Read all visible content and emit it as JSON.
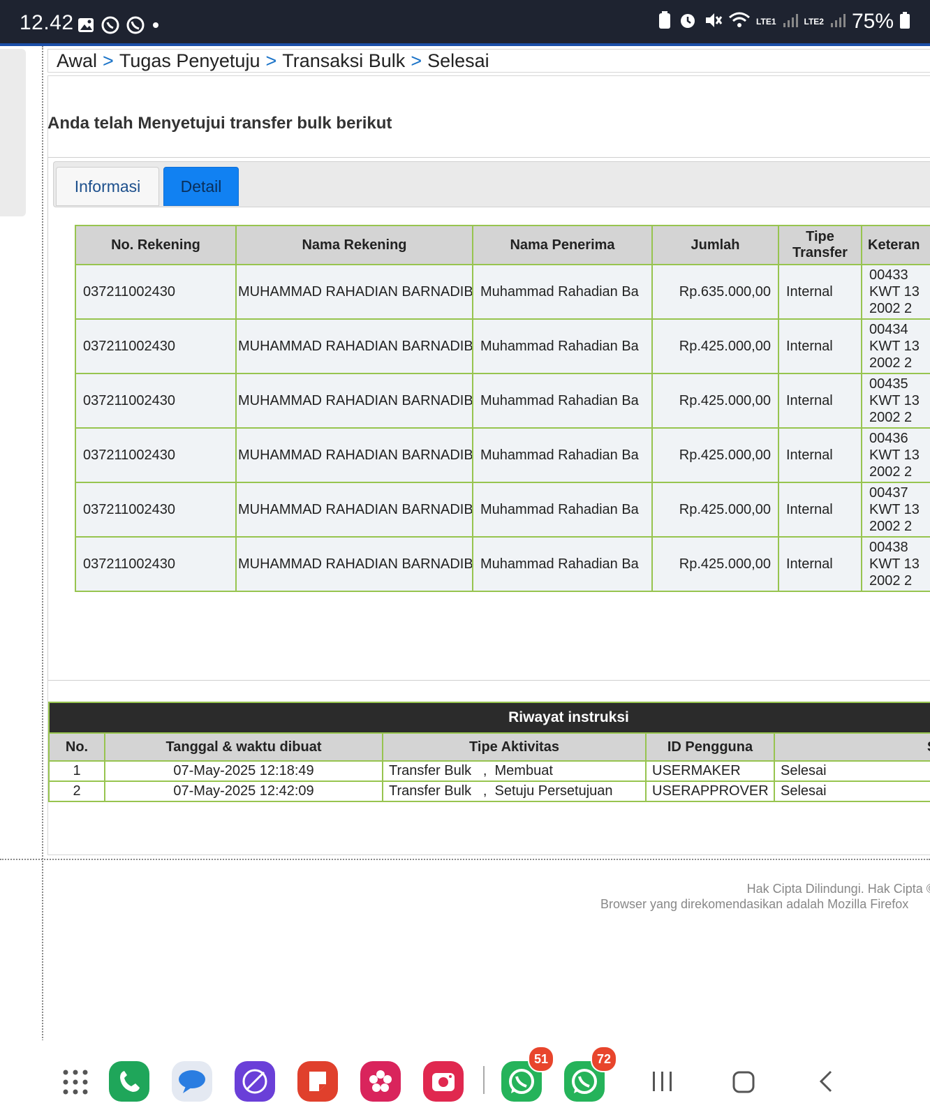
{
  "status_bar": {
    "time": "12.42",
    "battery": "75%",
    "network_labels": [
      "LTE1",
      "LTE2"
    ],
    "icons": [
      "gallery-icon",
      "sync-call-icon",
      "whatsapp-icon",
      "dot-icon",
      "battery-saver-icon",
      "alarm-icon",
      "mute-icon",
      "wifi-icon",
      "signal-icon",
      "signal-icon",
      "battery-icon"
    ]
  },
  "breadcrumb": {
    "items": [
      "Awal",
      "Tugas Penyetuju",
      "Transaksi Bulk",
      "Selesai"
    ],
    "separator": ">"
  },
  "page": {
    "title": "Anda telah Menyetujui transfer bulk berikut"
  },
  "tabs": [
    {
      "label": "Informasi",
      "active": false
    },
    {
      "label": "Detail",
      "active": true
    }
  ],
  "detail_table": {
    "headers": [
      "No. Rekening",
      "Nama Rekening",
      "Nama Penerima",
      "Jumlah",
      "Tipe Transfer",
      "Keteran"
    ],
    "rows": [
      {
        "rekening": "037211002430",
        "nama_rekening": "MUHAMMAD RAHADIAN BARNADIB",
        "penerima": "Muhammad Rahadian Ba",
        "jumlah": "Rp.635.000,00",
        "tipe": "Internal",
        "ket1": "00433",
        "ket2": "KWT 13",
        "ket3": "2002 2"
      },
      {
        "rekening": "037211002430",
        "nama_rekening": "MUHAMMAD RAHADIAN BARNADIB",
        "penerima": "Muhammad Rahadian Ba",
        "jumlah": "Rp.425.000,00",
        "tipe": "Internal",
        "ket1": "00434",
        "ket2": "KWT 13",
        "ket3": "2002 2"
      },
      {
        "rekening": "037211002430",
        "nama_rekening": "MUHAMMAD RAHADIAN BARNADIB",
        "penerima": "Muhammad Rahadian Ba",
        "jumlah": "Rp.425.000,00",
        "tipe": "Internal",
        "ket1": "00435",
        "ket2": "KWT 13",
        "ket3": "2002 2"
      },
      {
        "rekening": "037211002430",
        "nama_rekening": "MUHAMMAD RAHADIAN BARNADIB",
        "penerima": "Muhammad Rahadian Ba",
        "jumlah": "Rp.425.000,00",
        "tipe": "Internal",
        "ket1": "00436",
        "ket2": "KWT 13",
        "ket3": "2002 2"
      },
      {
        "rekening": "037211002430",
        "nama_rekening": "MUHAMMAD RAHADIAN BARNADIB",
        "penerima": "Muhammad Rahadian Ba",
        "jumlah": "Rp.425.000,00",
        "tipe": "Internal",
        "ket1": "00437",
        "ket2": "KWT 13",
        "ket3": "2002 2"
      },
      {
        "rekening": "037211002430",
        "nama_rekening": "MUHAMMAD RAHADIAN BARNADIB",
        "penerima": "Muhammad Rahadian Ba",
        "jumlah": "Rp.425.000,00",
        "tipe": "Internal",
        "ket1": "00438",
        "ket2": "KWT 13",
        "ket3": "2002 2"
      }
    ]
  },
  "history": {
    "title": "Riwayat instruksi",
    "headers": [
      "No.",
      "Tanggal & waktu dibuat",
      "Tipe Aktivitas",
      "ID Pengguna",
      "Status"
    ],
    "rows": [
      {
        "no": "1",
        "tanggal": "07-May-2025 12:18:49",
        "aktivitas": "Transfer Bulk   ,  Membuat",
        "pengguna": "USERMAKER",
        "status": "Selesai"
      },
      {
        "no": "2",
        "tanggal": "07-May-2025 12:42:09",
        "aktivitas": "Transfer Bulk   ,  Setuju Persetujuan",
        "pengguna": "USERAPPROVER",
        "status": "Selesai"
      }
    ]
  },
  "footer": {
    "line1": "Hak Cipta Dilindungi. Hak Cipta ©",
    "line2": "Browser yang direkomendasikan adalah Mozilla Firefox"
  },
  "dock": {
    "apps": [
      {
        "name": "app-drawer-icon",
        "color": "#444444"
      },
      {
        "name": "phone-icon",
        "color": "#1fa65a"
      },
      {
        "name": "messages-icon",
        "color": "#2a7de1"
      },
      {
        "name": "internet-browser-icon",
        "color": "#6a3fd8"
      },
      {
        "name": "notes-icon",
        "color": "#e0402c"
      },
      {
        "name": "gallery-app-icon",
        "color": "#d9245c"
      },
      {
        "name": "camera-icon",
        "color": "#e0284f"
      },
      {
        "name": "whatsapp-icon",
        "color": "#25b35a",
        "badge": "51"
      },
      {
        "name": "whatsapp-business-icon",
        "color": "#25b35a",
        "badge": "72"
      }
    ]
  }
}
